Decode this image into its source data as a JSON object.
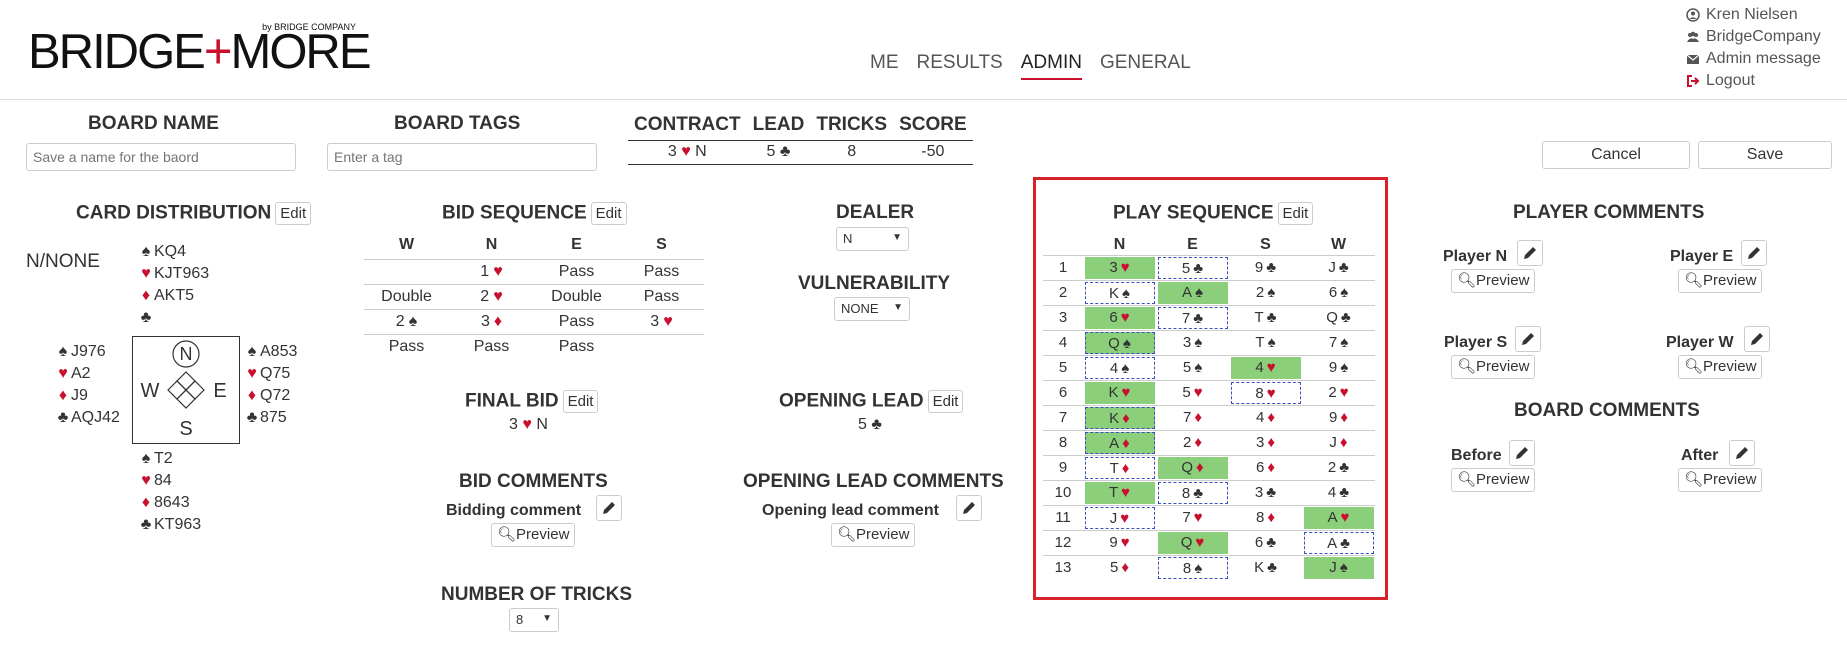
{
  "logo": {
    "brand_left": "BRIDGE",
    "brand_plus": "+",
    "brand_right": "MORE",
    "by_line": "by BRIDGE COMPANY"
  },
  "nav": [
    {
      "label": "ME",
      "active": false
    },
    {
      "label": "RESULTS",
      "active": false
    },
    {
      "label": "ADMIN",
      "active": true
    },
    {
      "label": "GENERAL",
      "active": false
    }
  ],
  "user_menu": {
    "user": "Kren Nielsen",
    "company": "BridgeCompany",
    "admin_message": "Admin message",
    "logout": "Logout"
  },
  "board_name": {
    "title": "BOARD NAME",
    "placeholder": "Save a name for the baord"
  },
  "board_tags": {
    "title": "BOARD TAGS",
    "placeholder": "Enter a tag"
  },
  "contract_table": {
    "headers": [
      "CONTRACT",
      "LEAD",
      "TRICKS",
      "SCORE"
    ],
    "contract_level": "3",
    "contract_suit": "♥",
    "contract_declarer": "N",
    "lead_rank": "5",
    "lead_suit": "♣",
    "tricks": "8",
    "score": "-50"
  },
  "actions": {
    "cancel": "Cancel",
    "save": "Save"
  },
  "card_distribution": {
    "title": "CARD DISTRIBUTION",
    "edit": "Edit",
    "board_info": "N/NONE",
    "north": {
      "spades": "KQ4",
      "hearts": "KJT963",
      "diamonds": "AKT5",
      "clubs": ""
    },
    "west": {
      "spades": "J976",
      "hearts": "A2",
      "diamonds": "J9",
      "clubs": "AQJ42"
    },
    "east": {
      "spades": "A853",
      "hearts": "Q75",
      "diamonds": "Q72",
      "clubs": "875"
    },
    "south": {
      "spades": "T2",
      "hearts": "84",
      "diamonds": "8643",
      "clubs": "KT963"
    },
    "compass": {
      "n": "N",
      "w": "W",
      "e": "E",
      "s": "S"
    }
  },
  "bid_sequence": {
    "title": "BID SEQUENCE",
    "edit": "Edit",
    "headers": [
      "W",
      "N",
      "E",
      "S"
    ],
    "rows": [
      [
        {
          "t": ""
        },
        {
          "t": "1",
          "s": "♥"
        },
        {
          "t": "Pass"
        },
        {
          "t": "Pass"
        }
      ],
      [
        {
          "t": "Double"
        },
        {
          "t": "2",
          "s": "♥"
        },
        {
          "t": "Double"
        },
        {
          "t": "Pass"
        }
      ],
      [
        {
          "t": "2",
          "s": "♠"
        },
        {
          "t": "3",
          "s": "♦"
        },
        {
          "t": "Pass"
        },
        {
          "t": "3",
          "s": "♥"
        }
      ],
      [
        {
          "t": "Pass"
        },
        {
          "t": "Pass"
        },
        {
          "t": "Pass"
        },
        {
          "t": ""
        }
      ]
    ]
  },
  "dealer": {
    "title": "DEALER",
    "value": "N"
  },
  "vulnerability": {
    "title": "VULNERABILITY",
    "value": "NONE"
  },
  "final_bid": {
    "title": "FINAL BID",
    "edit": "Edit",
    "level": "3",
    "suit": "♥",
    "declarer": "N"
  },
  "opening_lead": {
    "title": "OPENING LEAD",
    "edit": "Edit",
    "rank": "5",
    "suit": "♣"
  },
  "bid_comments": {
    "title": "BID COMMENTS",
    "label": "Bidding comment",
    "preview": "Preview"
  },
  "opening_lead_comments": {
    "title": "OPENING LEAD COMMENTS",
    "label": "Opening lead comment",
    "preview": "Preview"
  },
  "number_of_tricks": {
    "title": "NUMBER OF TRICKS",
    "value": "8"
  },
  "play_sequence": {
    "title": "PLAY SEQUENCE",
    "edit": "Edit",
    "headers": [
      "N",
      "E",
      "S",
      "W"
    ],
    "rows": [
      {
        "num": "1",
        "cards": [
          {
            "r": "3",
            "s": "♥",
            "win": true,
            "lead": false
          },
          {
            "r": "5",
            "s": "♣",
            "win": false,
            "lead": true
          },
          {
            "r": "9",
            "s": "♣",
            "win": false,
            "lead": false
          },
          {
            "r": "J",
            "s": "♣",
            "win": false,
            "lead": false
          }
        ]
      },
      {
        "num": "2",
        "cards": [
          {
            "r": "K",
            "s": "♠",
            "win": false,
            "lead": true
          },
          {
            "r": "A",
            "s": "♠",
            "win": true,
            "lead": false
          },
          {
            "r": "2",
            "s": "♠",
            "win": false,
            "lead": false
          },
          {
            "r": "6",
            "s": "♠",
            "win": false,
            "lead": false
          }
        ]
      },
      {
        "num": "3",
        "cards": [
          {
            "r": "6",
            "s": "♥",
            "win": true,
            "lead": false
          },
          {
            "r": "7",
            "s": "♣",
            "win": false,
            "lead": true
          },
          {
            "r": "T",
            "s": "♣",
            "win": false,
            "lead": false
          },
          {
            "r": "Q",
            "s": "♣",
            "win": false,
            "lead": false
          }
        ]
      },
      {
        "num": "4",
        "cards": [
          {
            "r": "Q",
            "s": "♠",
            "win": true,
            "lead": true
          },
          {
            "r": "3",
            "s": "♠",
            "win": false,
            "lead": false
          },
          {
            "r": "T",
            "s": "♠",
            "win": false,
            "lead": false
          },
          {
            "r": "7",
            "s": "♠",
            "win": false,
            "lead": false
          }
        ]
      },
      {
        "num": "5",
        "cards": [
          {
            "r": "4",
            "s": "♠",
            "win": false,
            "lead": true
          },
          {
            "r": "5",
            "s": "♠",
            "win": false,
            "lead": false
          },
          {
            "r": "4",
            "s": "♥",
            "win": true,
            "lead": false
          },
          {
            "r": "9",
            "s": "♠",
            "win": false,
            "lead": false
          }
        ]
      },
      {
        "num": "6",
        "cards": [
          {
            "r": "K",
            "s": "♥",
            "win": true,
            "lead": false
          },
          {
            "r": "5",
            "s": "♥",
            "win": false,
            "lead": false
          },
          {
            "r": "8",
            "s": "♥",
            "win": false,
            "lead": true
          },
          {
            "r": "2",
            "s": "♥",
            "win": false,
            "lead": false
          }
        ]
      },
      {
        "num": "7",
        "cards": [
          {
            "r": "K",
            "s": "♦",
            "win": true,
            "lead": true
          },
          {
            "r": "7",
            "s": "♦",
            "win": false,
            "lead": false
          },
          {
            "r": "4",
            "s": "♦",
            "win": false,
            "lead": false
          },
          {
            "r": "9",
            "s": "♦",
            "win": false,
            "lead": false
          }
        ]
      },
      {
        "num": "8",
        "cards": [
          {
            "r": "A",
            "s": "♦",
            "win": true,
            "lead": true
          },
          {
            "r": "2",
            "s": "♦",
            "win": false,
            "lead": false
          },
          {
            "r": "3",
            "s": "♦",
            "win": false,
            "lead": false
          },
          {
            "r": "J",
            "s": "♦",
            "win": false,
            "lead": false
          }
        ]
      },
      {
        "num": "9",
        "cards": [
          {
            "r": "T",
            "s": "♦",
            "win": false,
            "lead": true
          },
          {
            "r": "Q",
            "s": "♦",
            "win": true,
            "lead": false
          },
          {
            "r": "6",
            "s": "♦",
            "win": false,
            "lead": false
          },
          {
            "r": "2",
            "s": "♣",
            "win": false,
            "lead": false
          }
        ]
      },
      {
        "num": "10",
        "cards": [
          {
            "r": "T",
            "s": "♥",
            "win": true,
            "lead": false
          },
          {
            "r": "8",
            "s": "♣",
            "win": false,
            "lead": true
          },
          {
            "r": "3",
            "s": "♣",
            "win": false,
            "lead": false
          },
          {
            "r": "4",
            "s": "♣",
            "win": false,
            "lead": false
          }
        ]
      },
      {
        "num": "11",
        "cards": [
          {
            "r": "J",
            "s": "♥",
            "win": false,
            "lead": true
          },
          {
            "r": "7",
            "s": "♥",
            "win": false,
            "lead": false
          },
          {
            "r": "8",
            "s": "♦",
            "win": false,
            "lead": false
          },
          {
            "r": "A",
            "s": "♥",
            "win": true,
            "lead": false
          }
        ]
      },
      {
        "num": "12",
        "cards": [
          {
            "r": "9",
            "s": "♥",
            "win": false,
            "lead": false
          },
          {
            "r": "Q",
            "s": "♥",
            "win": true,
            "lead": false
          },
          {
            "r": "6",
            "s": "♣",
            "win": false,
            "lead": false
          },
          {
            "r": "A",
            "s": "♣",
            "win": false,
            "lead": true
          }
        ]
      },
      {
        "num": "13",
        "cards": [
          {
            "r": "5",
            "s": "♦",
            "win": false,
            "lead": false
          },
          {
            "r": "8",
            "s": "♠",
            "win": false,
            "lead": true
          },
          {
            "r": "K",
            "s": "♣",
            "win": false,
            "lead": false
          },
          {
            "r": "J",
            "s": "♠",
            "win": true,
            "lead": false
          }
        ]
      }
    ]
  },
  "player_comments": {
    "title": "PLAYER COMMENTS",
    "n": "Player N",
    "e": "Player E",
    "s": "Player S",
    "w": "Player W",
    "preview": "Preview"
  },
  "board_comments": {
    "title": "BOARD COMMENTS",
    "before": "Before",
    "after": "After",
    "preview": "Preview"
  },
  "colors": {
    "accent": "#c8102e",
    "winner_bg": "#8ccf7a",
    "lead_border": "#3b4fc4",
    "highlight_box": "#d9232b"
  }
}
